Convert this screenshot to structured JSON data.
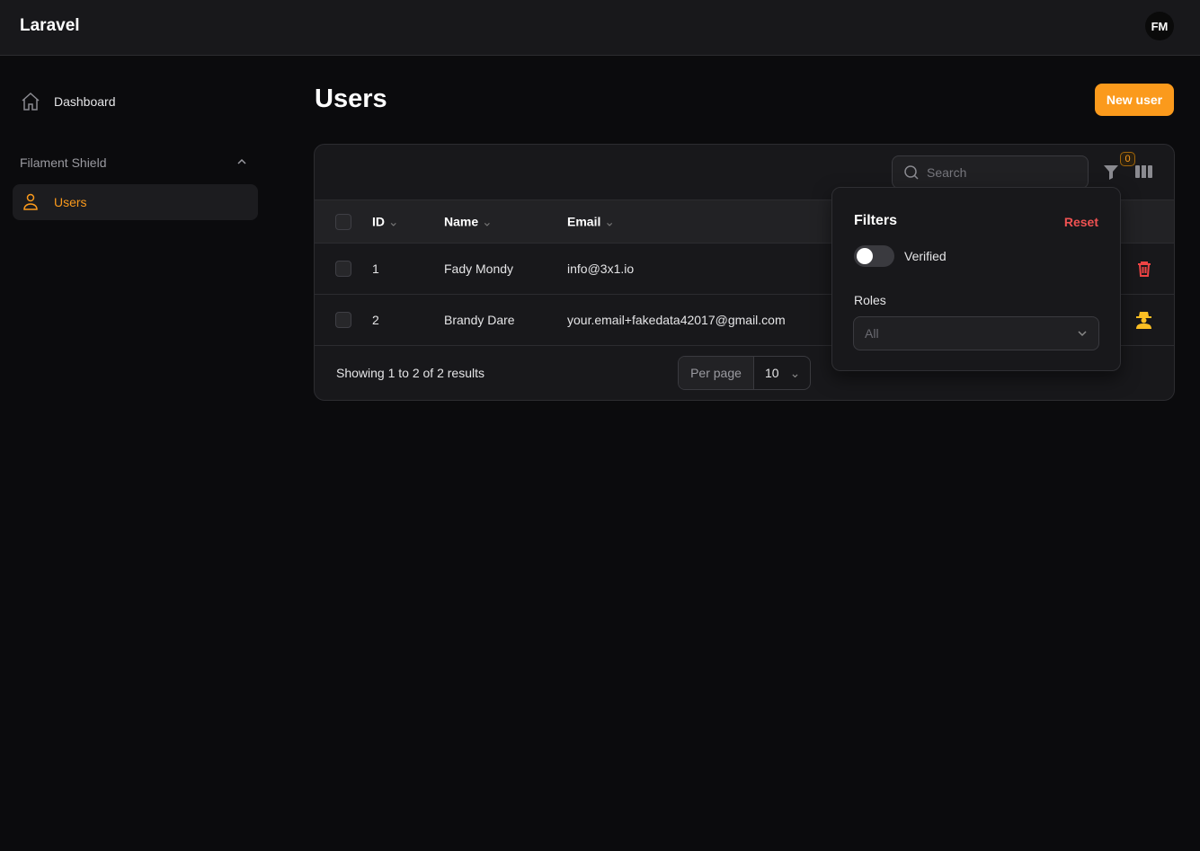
{
  "app": {
    "brand": "Laravel",
    "avatar_initials": "FM"
  },
  "sidebar": {
    "items": [
      {
        "label": "Dashboard",
        "icon": "home-icon"
      }
    ],
    "group": {
      "label": "Filament Shield",
      "items": [
        {
          "label": "Users",
          "icon": "user-icon",
          "active": true
        }
      ]
    }
  },
  "page": {
    "title": "Users",
    "new_button": "New user"
  },
  "table": {
    "search_placeholder": "Search",
    "filter_count": "0",
    "columns": [
      "ID",
      "Name",
      "Email"
    ],
    "rows": [
      {
        "id": "1",
        "name": "Fady Mondy",
        "email": "info@3x1.io"
      },
      {
        "id": "2",
        "name": "Brandy Dare",
        "email": "your.email+fakedata42017@gmail.com"
      }
    ],
    "summary": "Showing 1 to 2 of 2 results",
    "per_page_label": "Per page",
    "per_page": "10"
  },
  "filters": {
    "title": "Filters",
    "reset": "Reset",
    "verified_label": "Verified",
    "verified": false,
    "roles_label": "Roles",
    "roles_value": "All"
  },
  "colors": {
    "accent": "#fb9a1c",
    "danger": "#ef4444"
  }
}
